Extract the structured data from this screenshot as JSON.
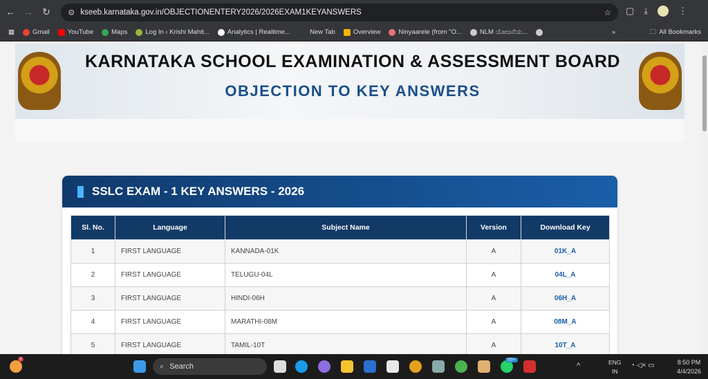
{
  "browser": {
    "url": "kseeb.karnataka.gov.in/OBJECTIONENTERY2026/2026EXAM1KEYANSWERS",
    "bookmarks": [
      "Gmail",
      "YouTube",
      "Maps",
      "Log In ‹ Krishi Mahit...",
      "Analytics | Realtime...",
      "New Tab",
      "Overview",
      "Ninyaarele (from \"O...",
      "NLM ಯೋಜನೆಯ..."
    ],
    "all_bookmarks": "All Bookmarks"
  },
  "banner": {
    "title": "KARNATAKA SCHOOL EXAMINATION & ASSESSMENT BOARD",
    "subtitle": "OBJECTION TO KEY ANSWERS"
  },
  "card": {
    "title": "SSLC EXAM - 1 KEY ANSWERS - 2026",
    "columns": [
      "Sl. No.",
      "Language",
      "Subject Name",
      "Version",
      "Download Key"
    ],
    "rows": [
      {
        "no": "1",
        "lang": "FIRST LANGUAGE",
        "subject": "KANNADA-01K",
        "version": "A",
        "key": "01K_A"
      },
      {
        "no": "2",
        "lang": "FIRST LANGUAGE",
        "subject": "TELUGU-04L",
        "version": "A",
        "key": "04L_A"
      },
      {
        "no": "3",
        "lang": "FIRST LANGUAGE",
        "subject": "HINDI-06H",
        "version": "A",
        "key": "06H_A"
      },
      {
        "no": "4",
        "lang": "FIRST LANGUAGE",
        "subject": "MARATHI-08M",
        "version": "A",
        "key": "08M_A"
      },
      {
        "no": "5",
        "lang": "FIRST LANGUAGE",
        "subject": "TAMIL-10T",
        "version": "A",
        "key": "10T_A"
      }
    ]
  },
  "taskbar": {
    "search": "Search",
    "lang1": "ENG",
    "lang2": "IN",
    "time": "8:50 PM",
    "date": "4/4/2026",
    "widget_badge": "8",
    "whatsapp_badge": "99+"
  }
}
